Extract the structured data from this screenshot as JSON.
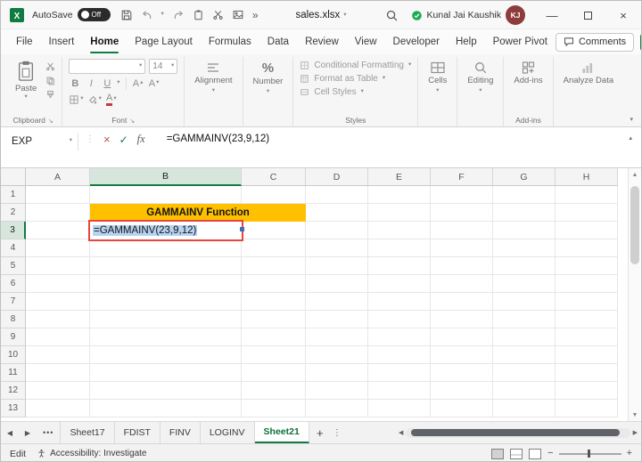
{
  "titlebar": {
    "autosave_label": "AutoSave",
    "autosave_state": "Off",
    "document_title": "sales.xlsx",
    "user_name": "Kunal Jai Kaushik",
    "user_initials": "KJ"
  },
  "menubar": {
    "tabs": [
      "File",
      "Insert",
      "Home",
      "Page Layout",
      "Formulas",
      "Data",
      "Review",
      "View",
      "Developer",
      "Help",
      "Power Pivot"
    ],
    "active_tab": "Home",
    "comments_label": "Comments"
  },
  "ribbon": {
    "paste_label": "Paste",
    "clipboard_group_label": "Clipboard",
    "font_group_label": "Font",
    "font_size_value": "14",
    "bold_label": "B",
    "italic_label": "I",
    "underline_label": "U",
    "font_letter": "A",
    "number_symbol": "%",
    "alignment_label": "Alignment",
    "number_label": "Number",
    "styles_items": [
      "Conditional Formatting",
      "Format as Table",
      "Cell Styles"
    ],
    "styles_group_label": "Styles",
    "cells_label": "Cells",
    "editing_label": "Editing",
    "addins_label": "Add-ins",
    "analyze_data_label": "Analyze Data"
  },
  "formula_bar": {
    "name_box_value": "EXP",
    "fx_label": "fx",
    "formula_value": "=GAMMAINV(23,9,12)"
  },
  "sheet": {
    "columns": [
      "A",
      "B",
      "C",
      "D",
      "E",
      "F",
      "G",
      "H"
    ],
    "rows": [
      "1",
      "2",
      "3",
      "4",
      "5",
      "6",
      "7",
      "8",
      "9",
      "10",
      "11",
      "12",
      "13"
    ],
    "selected_column": "B",
    "selected_row": "3",
    "title_cell": {
      "text": "GAMMAINV Function"
    },
    "editing_cell": {
      "text": "=GAMMAINV(23,9,12)"
    }
  },
  "tabbar": {
    "tabs": [
      "Sheet17",
      "FDIST",
      "FINV",
      "LOGINV",
      "Sheet21"
    ],
    "active_tab": "Sheet21"
  },
  "statusbar": {
    "mode": "Edit",
    "accessibility_text": "Accessibility: Investigate"
  },
  "icons": {
    "dropdown": "▾",
    "up_small": "▴",
    "overflow": "»",
    "more_sheets": "•••",
    "sheet_nav_left": "◀",
    "sheet_nav_right": "▶",
    "add_sheet": "+",
    "sheet_menu": "⋮",
    "cancel": "×",
    "enter": "✓",
    "minimize": "—",
    "close": "×",
    "formula_grip": "⋮",
    "zoom_out": "−",
    "zoom_in": "+",
    "scroll_up": "▲",
    "scroll_down": "▼",
    "launcher": "↘"
  },
  "colors": {
    "accent_green": "#107C41",
    "title_cell_fill": "#FFC000",
    "text_selection": "#B7D3F2",
    "editing_cell_border": "#E8453C",
    "avatar_bg": "#8E3B3B"
  }
}
